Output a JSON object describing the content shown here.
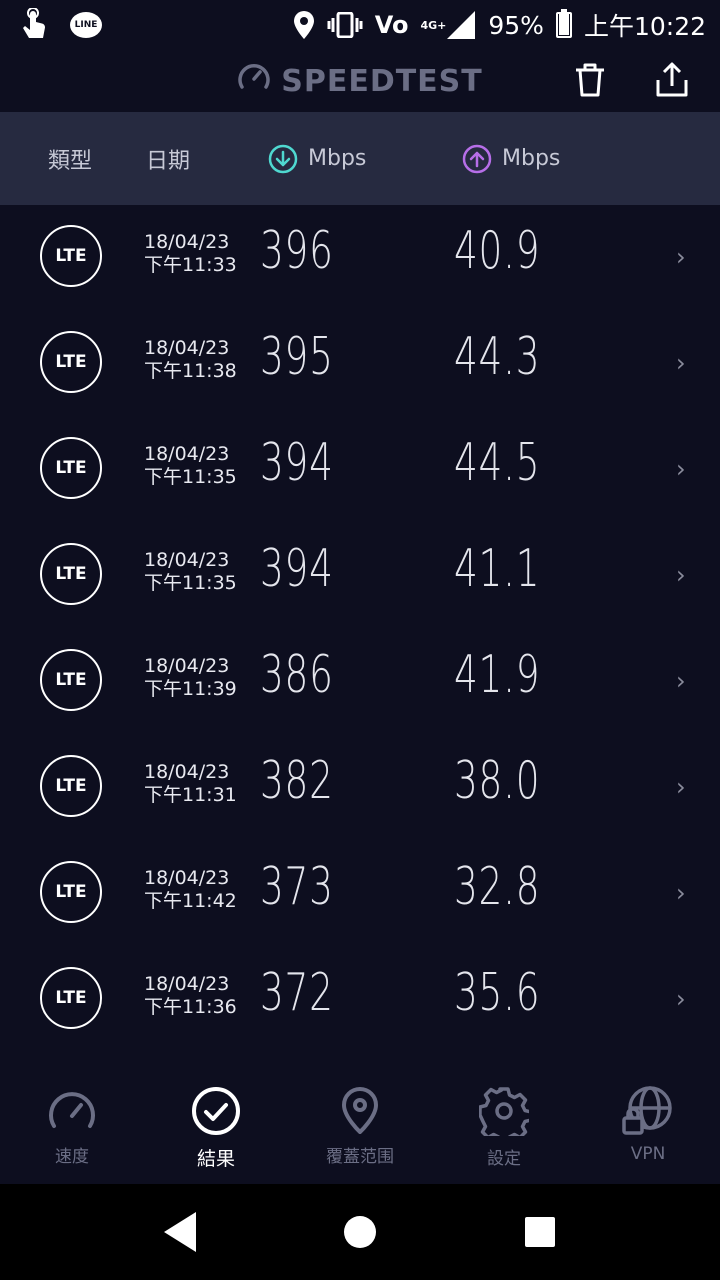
{
  "status_bar": {
    "battery": "95%",
    "time": "上午10:22",
    "volte": "Vo",
    "network": "4G+",
    "line_label": "LINE",
    "battery_level": 0.95
  },
  "header": {
    "title": "SPEEDTEST"
  },
  "table_header": {
    "type": "類型",
    "date": "日期",
    "download_unit": "Mbps",
    "upload_unit": "Mbps"
  },
  "rows": [
    {
      "type": "LTE",
      "date": "18/04/23",
      "time": "下午11:33",
      "download": "396",
      "upload": "40.9"
    },
    {
      "type": "LTE",
      "date": "18/04/23",
      "time": "下午11:38",
      "download": "395",
      "upload": "44.3"
    },
    {
      "type": "LTE",
      "date": "18/04/23",
      "time": "下午11:35",
      "download": "394",
      "upload": "44.5"
    },
    {
      "type": "LTE",
      "date": "18/04/23",
      "time": "下午11:35",
      "download": "394",
      "upload": "41.1"
    },
    {
      "type": "LTE",
      "date": "18/04/23",
      "time": "下午11:39",
      "download": "386",
      "upload": "41.9"
    },
    {
      "type": "LTE",
      "date": "18/04/23",
      "time": "下午11:31",
      "download": "382",
      "upload": "38.0"
    },
    {
      "type": "LTE",
      "date": "18/04/23",
      "time": "下午11:42",
      "download": "373",
      "upload": "32.8"
    },
    {
      "type": "LTE",
      "date": "18/04/23",
      "time": "下午11:36",
      "download": "372",
      "upload": "35.6"
    }
  ],
  "bottom_nav": {
    "items": [
      {
        "label": "速度",
        "icon": "speedometer-icon"
      },
      {
        "label": "結果",
        "icon": "check-circle-icon",
        "active": true
      },
      {
        "label": "覆蓋范围",
        "icon": "map-pin-icon"
      },
      {
        "label": "設定",
        "icon": "gear-icon"
      },
      {
        "label": "VPN",
        "icon": "vpn-globe-lock-icon"
      }
    ]
  },
  "colors": {
    "background": "#0d0e1f",
    "header_bar": "#262a40",
    "download_accent": "#4fd8d0",
    "upload_accent": "#b66ee8",
    "inactive": "#6b6e85"
  }
}
